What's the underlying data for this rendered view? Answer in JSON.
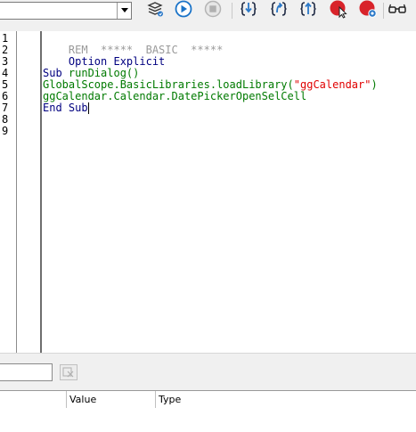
{
  "toolbar": {
    "library_select_value": "",
    "buttons": [
      {
        "name": "select-module-button",
        "icon": "stack-select-icon"
      },
      {
        "name": "run-button",
        "icon": "play-circle-icon"
      },
      {
        "name": "stop-button",
        "icon": "stop-icon"
      },
      {
        "name": "step-into-button",
        "icon": "step-into-icon"
      },
      {
        "name": "step-over-button",
        "icon": "step-over-icon"
      },
      {
        "name": "step-out-button",
        "icon": "step-out-icon"
      },
      {
        "name": "breakpoint-button",
        "icon": "breakpoint-cursor-icon"
      },
      {
        "name": "manage-breakpoints-button",
        "icon": "breakpoint-gear-icon"
      },
      {
        "name": "watch-button",
        "icon": "glasses-icon"
      }
    ],
    "colors": {
      "run": "#1a73c8",
      "breakpoint": "#d8232a"
    }
  },
  "editor": {
    "line_numbers": [
      "1",
      "2",
      "3",
      "4",
      "5",
      "6",
      "7",
      "8",
      "9"
    ],
    "lines": [
      {
        "comment": "REM  *****  BASIC  *****"
      },
      {
        "kw1": "Option Explicit"
      },
      {},
      {
        "kw1": "Sub ",
        "id1": "runDialog()"
      },
      {
        "id1": "GlobalScope.BasicLibraries.loadLibrary(",
        "str": "\"ggCalendar\"",
        "id2": ")"
      },
      {
        "id1": "ggCalendar.Calendar.DatePickerOpenSelCell"
      },
      {
        "kw1": "End Sub"
      }
    ],
    "colors": {
      "comment": "#9a9a9a",
      "keyword": "#000080",
      "identifier": "#007a00",
      "string": "#e00000"
    }
  },
  "watch": {
    "input_value": "",
    "remove_icon": "remove-watch-icon",
    "columns": [
      "",
      "Value",
      "Type"
    ]
  }
}
